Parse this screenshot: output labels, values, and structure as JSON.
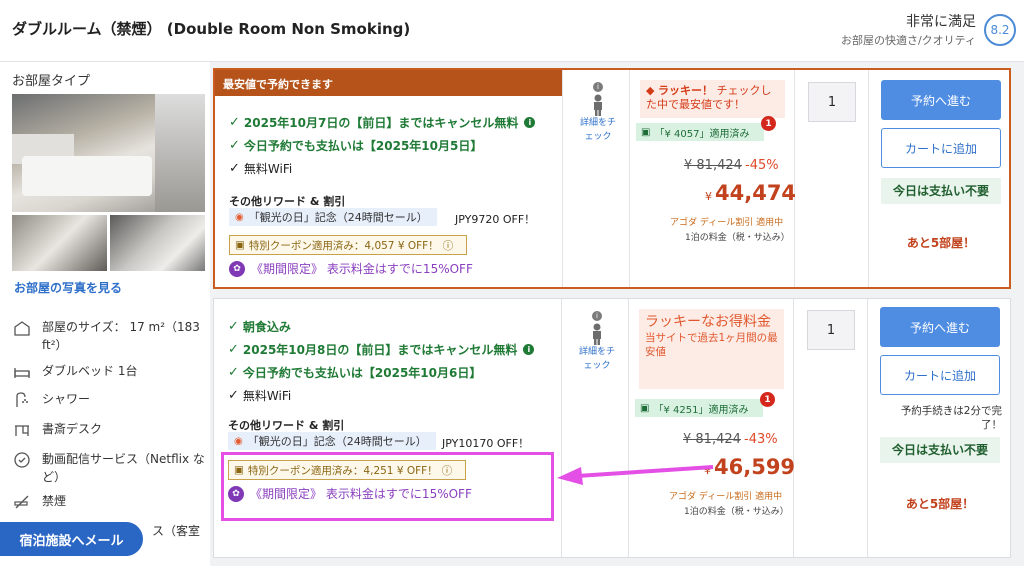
{
  "header": {
    "room_title": "ダブルルーム（禁煙） (Double Room Non Smoking)",
    "rating_label": "非常に満足",
    "rating_sub": "お部屋の快適さ/クオリティ",
    "rating_score": "8.2"
  },
  "sidebar": {
    "room_type_label": "お部屋タイプ",
    "photo_link": "お部屋の写真を見る",
    "amenities": [
      {
        "icon": "room-size-icon",
        "label": "部屋のサイズ： 17 m²（183 ft²）"
      },
      {
        "icon": "bed-icon",
        "label": "ダブルベッド 1台"
      },
      {
        "icon": "shower-icon",
        "label": "シャワー"
      },
      {
        "icon": "desk-icon",
        "label": "書斎デスク"
      },
      {
        "icon": "streaming-icon",
        "label": "動画配信サービス（Netflix など）"
      },
      {
        "icon": "no-smoking-icon",
        "label": "禁煙"
      },
      {
        "icon": "service-icon",
        "label": "ス（客室"
      }
    ],
    "mail_button": "宿泊施設へメール"
  },
  "offers": [
    {
      "banner": "最安値で予約できます",
      "features": [
        {
          "text": "2025年10月7日の【前日】まではキャンセル無料",
          "style": "green",
          "info": true
        },
        {
          "text": "今日予約でも支払いは【2025年10月5日】",
          "style": "green",
          "info": false
        },
        {
          "text": "無料WiFi",
          "style": "black",
          "info": false
        }
      ],
      "rewards_label": "その他リワード & 割引",
      "reward_tag": "「観光の日」記念（24時間セール）",
      "reward_amount": "JPY9720 OFF！",
      "coupon": "特別クーポン適用済み：4,057 ¥ OFF！",
      "promo": "《期間限定》 表示料金はすでに15%OFF",
      "occupancy_link": "詳細をチェック",
      "lucky_title": "ラッキー！",
      "lucky_text": "チェックした中で最安値です！",
      "coupon_applied": "「¥ 4057」適用済み",
      "coupon_badge": "1",
      "old_price": "¥ 81,424",
      "discount": "-45%",
      "currency": "¥",
      "price": "44,474",
      "deal_label": "アゴダ ディール割引 適用中",
      "per_night": "1泊の料金（税・サ込み）",
      "qty": "1",
      "book_button": "予約へ進む",
      "cart_button": "カートに追加",
      "pay_later": "今日は支払い不要",
      "rooms_left": "あと5部屋！"
    },
    {
      "features": [
        {
          "text": "朝食込み",
          "style": "green",
          "info": false
        },
        {
          "text": "2025年10月8日の【前日】まではキャンセル無料",
          "style": "green",
          "info": true
        },
        {
          "text": "今日予約でも支払いは【2025年10月6日】",
          "style": "green",
          "info": false
        },
        {
          "text": "無料WiFi",
          "style": "black",
          "info": false
        }
      ],
      "rewards_label": "その他リワード & 割引",
      "reward_tag": "「観光の日」記念（24時間セール）",
      "reward_amount": "JPY10170 OFF！",
      "coupon": "特別クーポン適用済み：4,251 ¥ OFF！",
      "promo": "《期間限定》 表示料金はすでに15%OFF",
      "occupancy_link": "詳細をチェック",
      "lucky_title": "ラッキーなお得料金",
      "lucky_text": "当サイトで過去1ヶ月間の最安値",
      "coupon_applied": "「¥ 4251」適用済み",
      "coupon_badge": "1",
      "old_price": "¥ 81,424",
      "discount": "-43%",
      "currency": "¥",
      "price": "46,599",
      "deal_label": "アゴダ ディール割引 適用中",
      "per_night": "1泊の料金（税・サ込み）",
      "qty": "1",
      "book_button": "予約へ進む",
      "cart_button": "カートに追加",
      "quick_note": "予約手続きは2分で完了！",
      "pay_later": "今日は支払い不要",
      "rooms_left": "あと5部屋！"
    }
  ],
  "colors": {
    "accent_blue": "#4f8de3",
    "highlight_magenta": "#e44fe5",
    "price_red": "#c2421d",
    "banner_orange": "#b5531a"
  }
}
